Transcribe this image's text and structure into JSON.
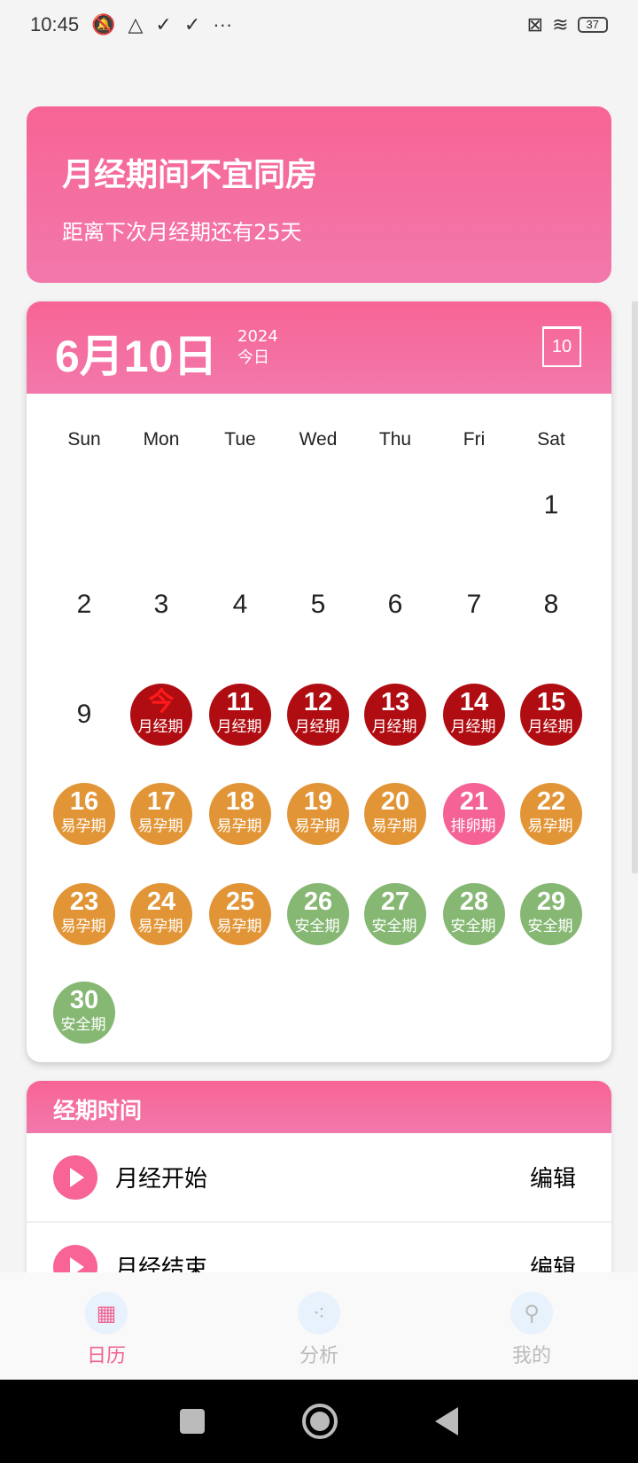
{
  "status": {
    "time": "10:45",
    "battery": "37",
    "icons": [
      "mute-icon",
      "app-icon",
      "download-done-icon",
      "download-done-icon",
      "more-icon"
    ]
  },
  "banner": {
    "title": "月经期间不宜同房",
    "subtitle": "距离下次月经期还有25天"
  },
  "calendar": {
    "date": "6月10日",
    "year": "2024",
    "today": "今日",
    "icon_day": "10",
    "weekdays": [
      "Sun",
      "Mon",
      "Tue",
      "Wed",
      "Thu",
      "Fri",
      "Sat"
    ],
    "first_weekday": 6,
    "days": [
      {
        "n": "1"
      },
      {
        "n": "2"
      },
      {
        "n": "3"
      },
      {
        "n": "4"
      },
      {
        "n": "5"
      },
      {
        "n": "6"
      },
      {
        "n": "7"
      },
      {
        "n": "8"
      },
      {
        "n": "9"
      },
      {
        "n": "今",
        "t": "月经期",
        "type": "period",
        "today": true
      },
      {
        "n": "11",
        "t": "月经期",
        "type": "period"
      },
      {
        "n": "12",
        "t": "月经期",
        "type": "period"
      },
      {
        "n": "13",
        "t": "月经期",
        "type": "period"
      },
      {
        "n": "14",
        "t": "月经期",
        "type": "period"
      },
      {
        "n": "15",
        "t": "月经期",
        "type": "period"
      },
      {
        "n": "16",
        "t": "易孕期",
        "type": "fertile"
      },
      {
        "n": "17",
        "t": "易孕期",
        "type": "fertile"
      },
      {
        "n": "18",
        "t": "易孕期",
        "type": "fertile"
      },
      {
        "n": "19",
        "t": "易孕期",
        "type": "fertile"
      },
      {
        "n": "20",
        "t": "易孕期",
        "type": "fertile"
      },
      {
        "n": "21",
        "t": "排卵期",
        "type": "ovulation"
      },
      {
        "n": "22",
        "t": "易孕期",
        "type": "fertile"
      },
      {
        "n": "23",
        "t": "易孕期",
        "type": "fertile"
      },
      {
        "n": "24",
        "t": "易孕期",
        "type": "fertile"
      },
      {
        "n": "25",
        "t": "易孕期",
        "type": "fertile"
      },
      {
        "n": "26",
        "t": "安全期",
        "type": "safe"
      },
      {
        "n": "27",
        "t": "安全期",
        "type": "safe"
      },
      {
        "n": "28",
        "t": "安全期",
        "type": "safe"
      },
      {
        "n": "29",
        "t": "安全期",
        "type": "safe"
      },
      {
        "n": "30",
        "t": "安全期",
        "type": "safe"
      }
    ]
  },
  "colors": {
    "period": "#b00d12",
    "fertile": "#e29536",
    "ovulation": "#f56396",
    "safe": "#86b874",
    "accent": "#f76495",
    "today_text": "#ff1a1a"
  },
  "section": {
    "title": "经期时间",
    "rows": [
      {
        "label": "月经开始",
        "action": "编辑"
      },
      {
        "label": "月经结束",
        "action": "编辑"
      }
    ]
  },
  "nav": [
    {
      "label": "日历",
      "icon": "calendar-icon",
      "active": true
    },
    {
      "label": "分析",
      "icon": "chart-icon"
    },
    {
      "label": "我的",
      "icon": "user-icon"
    }
  ]
}
